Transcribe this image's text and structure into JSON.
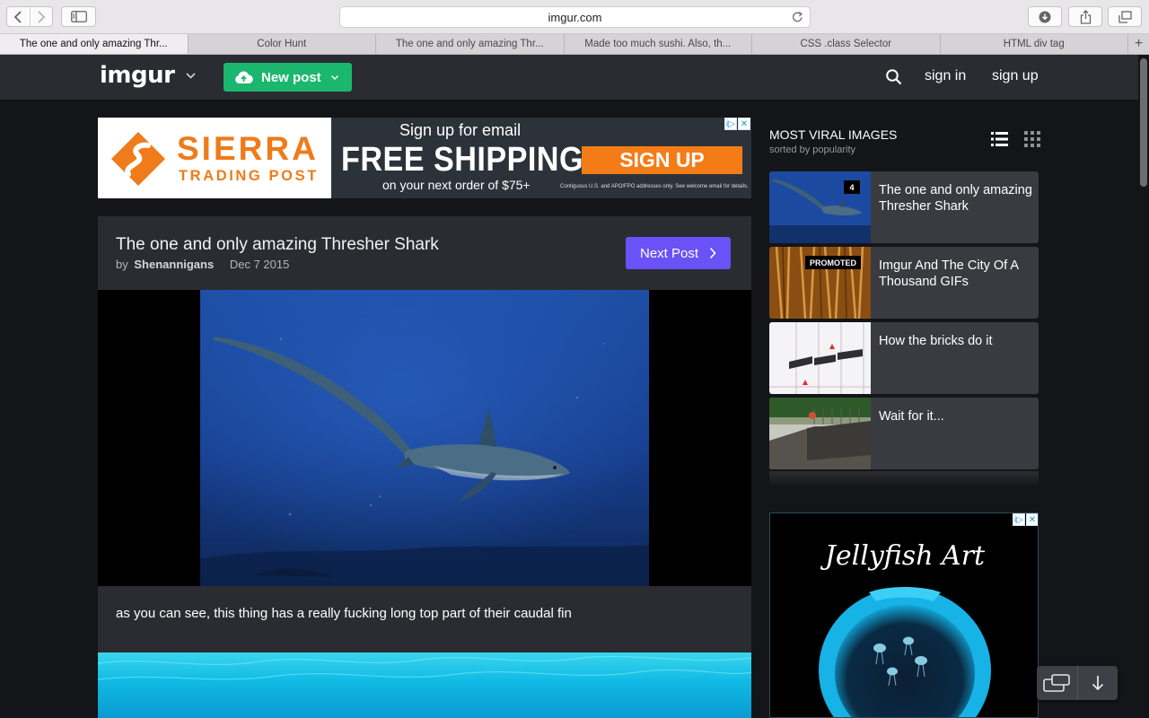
{
  "browser": {
    "address": "imgur.com",
    "tabs": [
      "The one and only amazing Thr...",
      "Color Hunt",
      "The one and only amazing Thr...",
      "Made too much sushi. Also, th...",
      "CSS .class Selector",
      "HTML div tag"
    ],
    "new_tab": "+"
  },
  "header": {
    "logo": "imgur",
    "new_post": "New post",
    "sign_in": "sign in",
    "sign_up": "sign up"
  },
  "ad_banner": {
    "brand": "SIERRA",
    "brand_sub": "TRADING POST",
    "line1": "Sign up for email",
    "line2": "FREE SHIPPING",
    "cta": "SIGN UP",
    "line3": "on your next order of $75+",
    "fine_print": "Contiguous U.S. and APO/FPO addresses only. See welcome email for details.",
    "adchoice_i": "i▷",
    "adchoice_x": "✕",
    "brand_color": "#ef7b1a"
  },
  "post": {
    "title": "The one and only amazing Thresher Shark",
    "by": "by",
    "author": "Shenannigans",
    "date": "Dec 7 2015",
    "next_label": "Next Post",
    "description": "as you can see, this thing has a really fucking long top part of their caudal fin"
  },
  "sidebar": {
    "title": "MOST VIRAL IMAGES",
    "subtitle": "sorted by popularity",
    "items": [
      {
        "label": "The one and only amazing Thresher Shark",
        "badge": "4"
      },
      {
        "label": "Imgur And The City Of A Thousand GIFs",
        "badge": "PROMOTED"
      },
      {
        "label": "How the bricks do it",
        "badge": ""
      },
      {
        "label": "Wait for it...",
        "badge": ""
      }
    ]
  },
  "side_ad": {
    "title": "Jellyfish Art",
    "adchoice_i": "i▷",
    "adchoice_x": "✕"
  },
  "colors": {
    "header_bg": "#2b2c31",
    "page_bg": "#141518",
    "new_post_green": "#1bb76e",
    "next_post_purple": "#6a52f7"
  }
}
